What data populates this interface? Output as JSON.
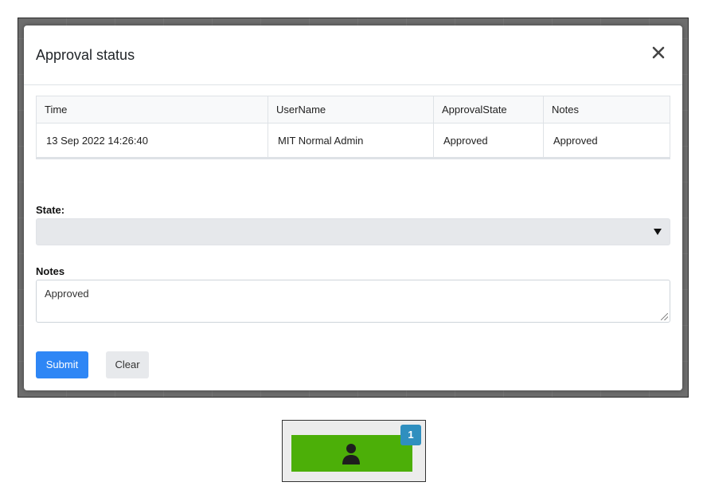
{
  "dialog": {
    "title": "Approval status",
    "close_icon": "close-icon"
  },
  "approvals_table": {
    "columns": [
      "Time",
      "UserName",
      "ApprovalState",
      "Notes"
    ],
    "rows": [
      [
        "13 Sep 2022 14:26:40",
        "MIT Normal Admin",
        "Approved",
        "Approved"
      ]
    ]
  },
  "form": {
    "state_label": "State:",
    "state_value": "",
    "notes_label": "Notes",
    "notes_value": "Approved"
  },
  "actions": {
    "submit_label": "Submit",
    "clear_label": "Clear"
  },
  "user_widget": {
    "icon": "person-icon",
    "badge_count": "1",
    "tile_color": "#4caf08",
    "badge_color": "#2f8fbf"
  },
  "colors": {
    "primary": "#2e86f5",
    "secondary": "#e7e9ec"
  }
}
